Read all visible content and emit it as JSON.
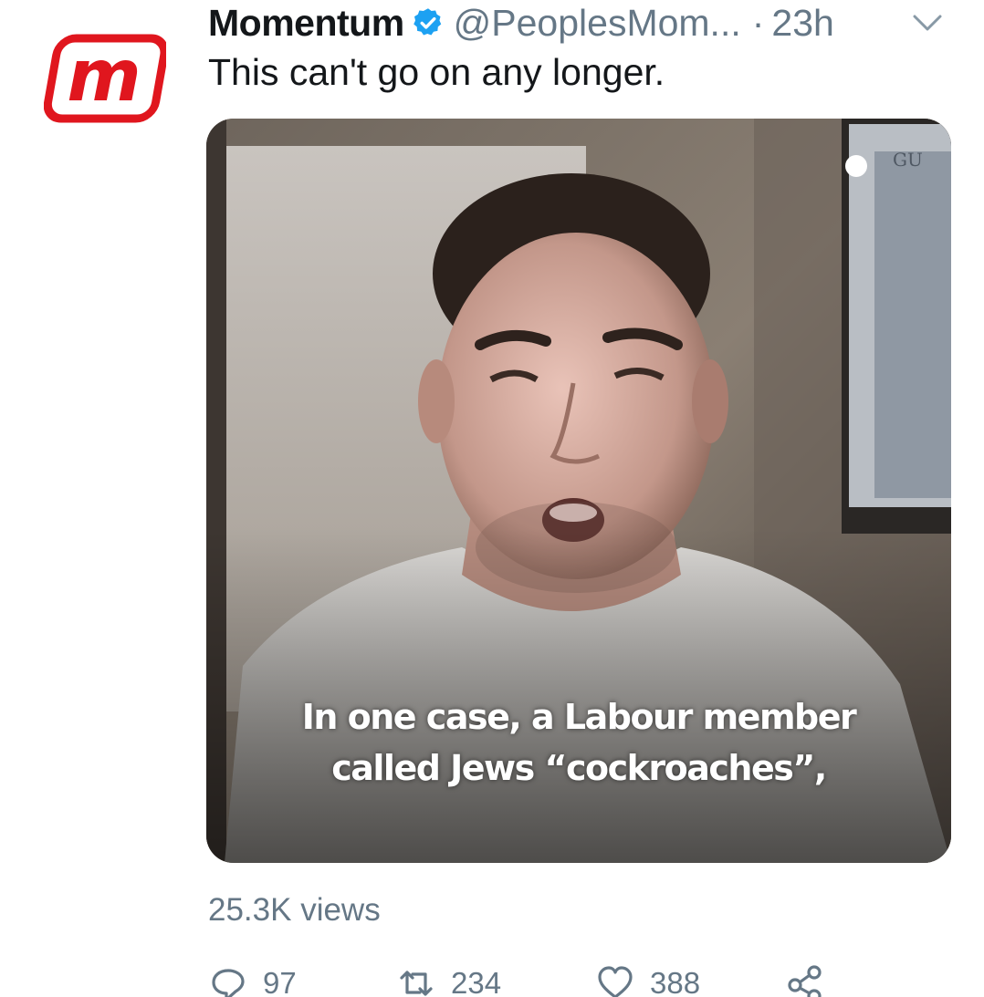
{
  "tweet": {
    "display_name": "Momentum",
    "handle": "@PeoplesMom...",
    "separator": "·",
    "time": "23h",
    "text": "This can't go on any longer.",
    "avatar_icon": "momentum-m-logo",
    "verified_icon": "verified-badge-icon",
    "menu_icon": "chevron-down-icon"
  },
  "media": {
    "caption_line1": "In one case, a Labour member",
    "caption_line2": "called Jews “cockroaches”,",
    "poster_text": "GU"
  },
  "stats": {
    "views": "25.3K views"
  },
  "actions": {
    "reply_count": "97",
    "retweet_count": "234",
    "like_count": "388",
    "reply_icon": "reply-icon",
    "retweet_icon": "retweet-icon",
    "like_icon": "heart-icon",
    "share_icon": "share-icon"
  },
  "colors": {
    "brand_red": "#e0161e",
    "verified_blue": "#1da1f2",
    "text_primary": "#14171a",
    "text_secondary": "#657786"
  }
}
